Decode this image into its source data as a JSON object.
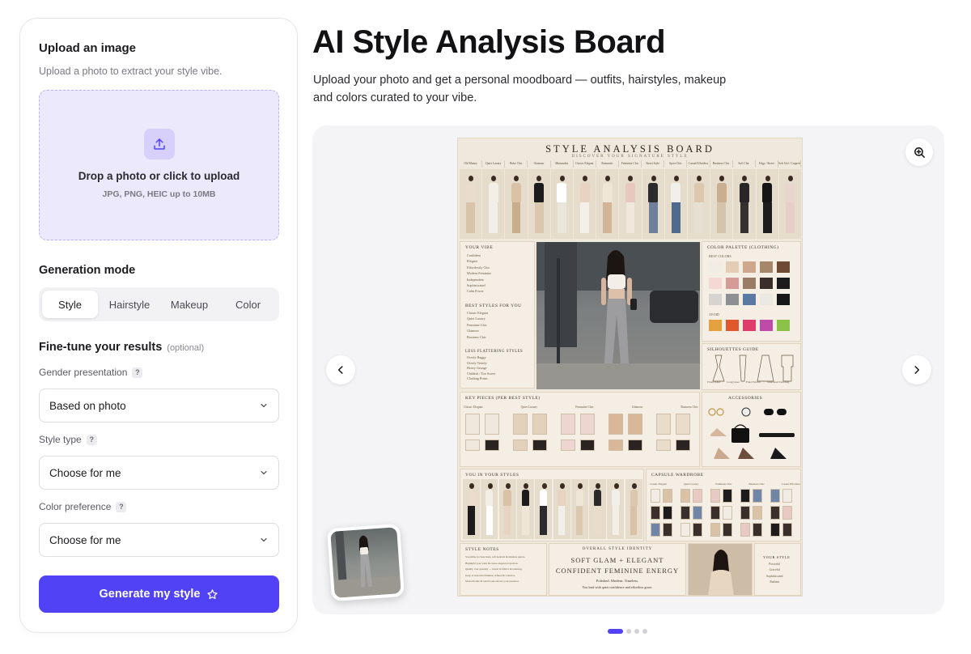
{
  "sidebar": {
    "upload_heading": "Upload an image",
    "upload_subtext": "Upload a photo to extract your style vibe.",
    "dropzone_title": "Drop a photo or click to upload",
    "dropzone_formats": "JPG, PNG, HEIC up to 10MB",
    "mode_heading": "Generation mode",
    "mode_tabs": [
      {
        "label": "Style",
        "active": true
      },
      {
        "label": "Hairstyle",
        "active": false
      },
      {
        "label": "Makeup",
        "active": false
      },
      {
        "label": "Color",
        "active": false
      }
    ],
    "tune_heading": "Fine-tune your results",
    "tune_optional": "(optional)",
    "fields": [
      {
        "label": "Gender presentation",
        "value": "Based on photo"
      },
      {
        "label": "Style type",
        "value": "Choose for me"
      },
      {
        "label": "Color preference",
        "value": "Choose for me"
      }
    ],
    "generate_label": "Generate my style",
    "accent_color": "#5142f6"
  },
  "main": {
    "title": "AI Style Analysis Board",
    "description": "Upload your photo and get a personal moodboard — outfits, hairstyles, makeup and colors curated to your vibe.",
    "carousel": {
      "active_index": 0,
      "total": 4
    }
  },
  "board": {
    "title": "STYLE ANALYSIS BOARD",
    "subtitle": "DISCOVER YOUR SIGNATURE STYLE",
    "categories": [
      "Old Money",
      "Quiet Luxury",
      "Boho Chic",
      "Glamour",
      "Minimalist",
      "Classic Elegant",
      "Romantic",
      "Feminine Chic",
      "Street Style",
      "Sport Chic",
      "Casual Effortless",
      "Business Chic",
      "Soft Chic",
      "Edgy / Street",
      "Soft Girl / Coquette"
    ],
    "your_vibe": {
      "heading": "YOUR VIBE",
      "items": [
        "Confident",
        "Elegant",
        "Effortlessly Chic",
        "Modern Feminine",
        "Independent",
        "Sophisticated",
        "Calm Power"
      ]
    },
    "best_styles": {
      "heading": "BEST STYLES FOR YOU",
      "items": [
        "Classic Elegant",
        "Quiet Luxury",
        "Feminine Chic",
        "Glamour",
        "Business Chic"
      ]
    },
    "less_flattering": {
      "heading": "LESS FLATTERING STYLES",
      "items": [
        "Overly Baggy",
        "Overly Trendy",
        "Heavy Grunge",
        "Childish / Too Sweet",
        "Clashing Prints"
      ]
    },
    "palette": {
      "heading": "COLOR PALETTE (CLOTHING)",
      "best_label": "BEST COLORS",
      "avoid_label": "AVOID",
      "best": [
        "#f2ede4",
        "#e3cdb6",
        "#cfa88c",
        "#a7876a",
        "#6f4a34",
        "#f3d8d4",
        "#d79b97",
        "#9a7b66",
        "#3a2e2a",
        "#1b1b1e",
        "#d6d4d1",
        "#8d8f93",
        "#5b7aa3",
        "#ece9e2",
        "#17171a"
      ],
      "avoid": [
        "#e5a13f",
        "#e0592d",
        "#de3d6b",
        "#bf4aa8",
        "#8cc24a"
      ]
    },
    "silhouettes": {
      "heading": "SILHOUETTES GUIDE",
      "items": [
        "Fitted Waist",
        "Long Lines",
        "Fluid Fabrics",
        "Structured Tailoring"
      ]
    },
    "key_pieces": {
      "heading": "KEY PIECES (PER BEST STYLE)",
      "items": [
        "Classic Elegant",
        "Quiet Luxury",
        "Feminine Chic",
        "Glamour",
        "Business Chic"
      ]
    },
    "accessories": {
      "heading": "ACCESSORIES"
    },
    "you_in_styles": {
      "heading": "YOU IN YOUR STYLES"
    },
    "capsule": {
      "heading": "CAPSULE WARDROBE",
      "items": [
        "Classic Elegant",
        "Quiet Luxury",
        "Feminine Chic",
        "Business Chic",
        "Casual Effortless"
      ]
    },
    "style_notes": {
      "heading": "STYLE NOTES",
      "items": [
        "You shine in clean lines, soft neutrals & timeless pieces.",
        "Highlight your waist & create elegant proportion.",
        "Quality over quantity — invest in fabrics & tailoring.",
        "Keep accessories minimal, refined & cohesive.",
        "Monochrome & tonal looks elevate your presence."
      ]
    },
    "identity": {
      "heading": "OVERALL STYLE IDENTITY",
      "line1": "SOFT GLAM + ELEGANT",
      "line2": "CONFIDENT FEMININE ENERGY",
      "tagline1": "Polished. Modern. Timeless.",
      "tagline2": "You lead with quiet confidence and effortless grace."
    },
    "your_style": {
      "heading": "YOUR STYLE",
      "items": [
        "Powerful",
        "Graceful",
        "Sophisticated",
        "Radiant"
      ]
    }
  }
}
